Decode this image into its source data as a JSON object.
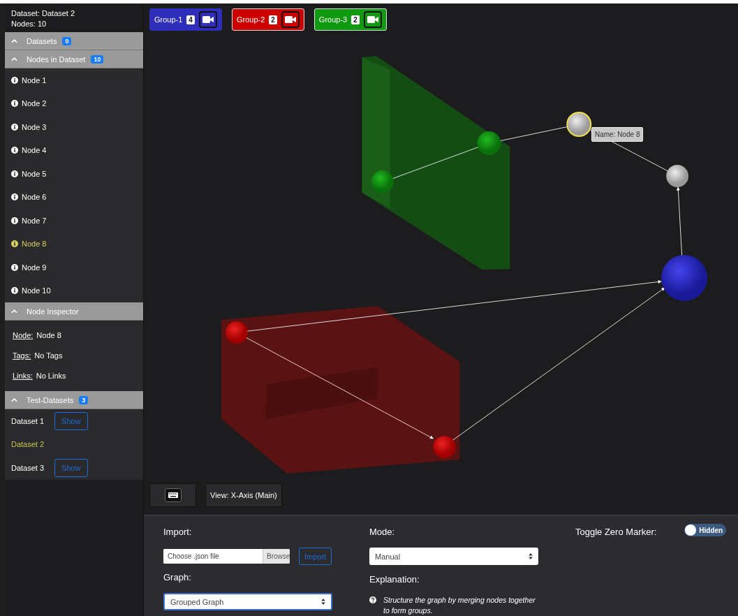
{
  "header": {
    "dataset": "Dataset: Dataset 2",
    "nodes": "Nodes: 10"
  },
  "datasets_section": {
    "title": "Datasets",
    "count": "0",
    "expanded": true
  },
  "nodes_section": {
    "title": "Nodes in Dataset",
    "count": "10",
    "expanded": true,
    "items": [
      {
        "label": "Node 1",
        "selected": false
      },
      {
        "label": "Node 2",
        "selected": false
      },
      {
        "label": "Node 3",
        "selected": false
      },
      {
        "label": "Node 4",
        "selected": false
      },
      {
        "label": "Node 5",
        "selected": false
      },
      {
        "label": "Node 6",
        "selected": false
      },
      {
        "label": "Node 7",
        "selected": false
      },
      {
        "label": "Node 8",
        "selected": true
      },
      {
        "label": "Node 9",
        "selected": false
      },
      {
        "label": "Node 10",
        "selected": false
      }
    ]
  },
  "inspector": {
    "title": "Node Inspector",
    "expanded": true,
    "fields": [
      {
        "label": "Node:",
        "value": "Node 8"
      },
      {
        "label": "Tags:",
        "value": "No Tags"
      },
      {
        "label": "Links:",
        "value": "No Links"
      }
    ]
  },
  "test_datasets": {
    "title": "Test-Datasets",
    "count": "3",
    "expanded": true,
    "items": [
      {
        "label": "Dataset 1",
        "selected": false,
        "button": "Show"
      },
      {
        "label": "Dataset 2",
        "selected": true
      },
      {
        "label": "Dataset 3",
        "selected": false,
        "button": "Show"
      }
    ]
  },
  "groups": [
    {
      "label": "Group-1",
      "count": "4",
      "color": "#2e2eb8"
    },
    {
      "label": "Group-2",
      "count": "2",
      "color": "#cc0000"
    },
    {
      "label": "Group-3",
      "count": "2",
      "color": "#119911"
    }
  ],
  "scene": {
    "tooltip": "Name: Node 8"
  },
  "view_button": "View: X-Axis (Main)",
  "controls": {
    "import": {
      "label": "Import:",
      "placeholder": "Choose .json file",
      "browse": "Browse",
      "button": "Import"
    },
    "graph": {
      "label": "Graph:",
      "value": "Grouped Graph"
    },
    "mode": {
      "label": "Mode:",
      "value": "Manual"
    },
    "explanation": {
      "label": "Explanation:",
      "text": "Structure the graph by merging nodes together to form groups."
    },
    "zero_marker": {
      "label": "Toggle Zero Marker:",
      "on": false,
      "state_label": "Hidden"
    }
  }
}
